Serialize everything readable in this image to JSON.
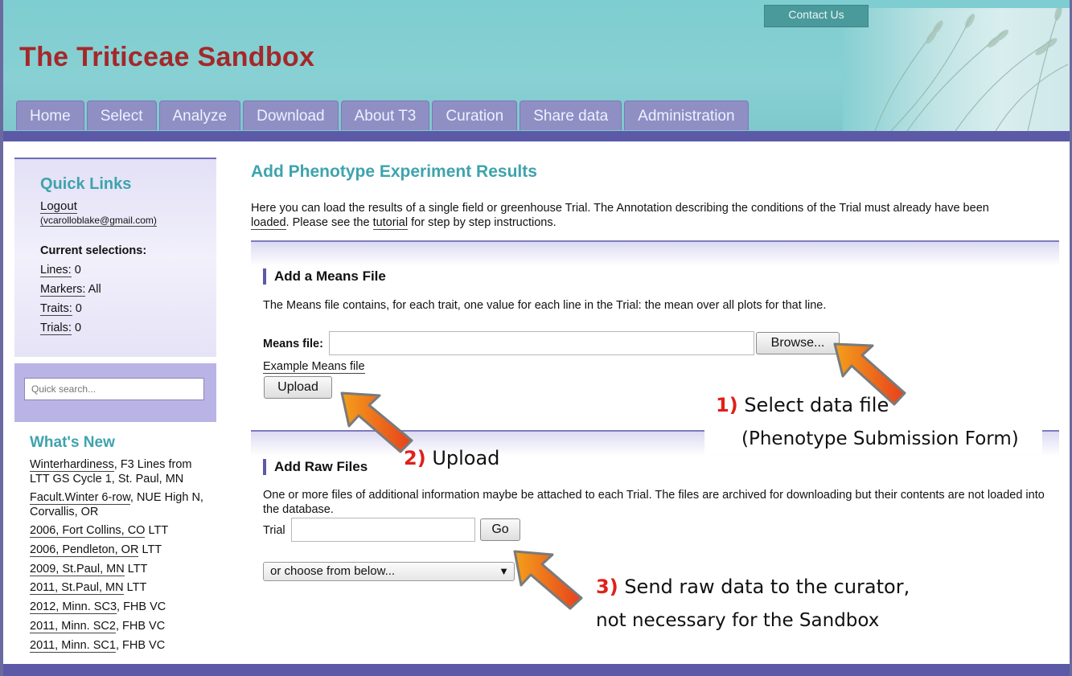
{
  "header": {
    "site_title": "The Triticeae Sandbox",
    "contact_label": "Contact Us"
  },
  "nav": {
    "tabs": [
      "Home",
      "Select",
      "Analyze",
      "Download",
      "About T3",
      "Curation",
      "Share data",
      "Administration"
    ]
  },
  "sidebar": {
    "quick_links_title": "Quick Links",
    "logout_label": "Logout",
    "user_email": "(vcarolloblake@gmail.com)",
    "current_selections_label": "Current selections:",
    "selections": [
      {
        "label": "Lines:",
        "value": "0"
      },
      {
        "label": "Markers:",
        "value": "All"
      },
      {
        "label": "Traits:",
        "value": "0"
      },
      {
        "label": "Trials:",
        "value": "0"
      }
    ],
    "search_placeholder": "Quick search...",
    "whats_new_title": "What's New",
    "whats_new": [
      {
        "link": "Winterhardiness",
        "rest": ", F3 Lines from LTT GS Cycle 1, St. Paul, MN"
      },
      {
        "link": "Facult.Winter 6-row",
        "rest": ", NUE High N, Corvallis, OR"
      },
      {
        "link": "2006, Fort Collins, CO",
        "rest": " LTT"
      },
      {
        "link": "2006, Pendleton, OR",
        "rest": " LTT"
      },
      {
        "link": "2009, St.Paul, MN",
        "rest": " LTT"
      },
      {
        "link": "2011, St.Paul, MN",
        "rest": " LTT"
      },
      {
        "link": "2012, Minn. SC3",
        "rest": ", FHB VC"
      },
      {
        "link": "2011, Minn. SC2",
        "rest": ", FHB VC"
      },
      {
        "link": "2011, Minn. SC1",
        "rest": ", FHB VC"
      }
    ]
  },
  "main": {
    "title": "Add Phenotype Experiment Results",
    "intro_part1": "Here you can load the results of a single field or greenhouse Trial. The Annotation describing the conditions of the Trial must already have been",
    "intro_loaded_link": "loaded",
    "intro_part2": ". Please see the ",
    "intro_tutorial_link": "tutorial",
    "intro_part3": " for step by step instructions.",
    "means": {
      "heading": "Add a Means File",
      "description": "The Means file contains, for each trait, one value for each line in the Trial: the mean over all plots for that line.",
      "file_label": "Means file:",
      "browse_label": "Browse...",
      "example_link": "Example Means file",
      "upload_label": "Upload"
    },
    "raw": {
      "heading": "Add Raw Files",
      "description": "One or more files of additional information maybe be attached to each Trial. The files are archived for downloading but their contents are not loaded into the database.",
      "trial_label": "Trial",
      "go_label": "Go",
      "choose_placeholder": "or choose from below..."
    }
  },
  "annotations": [
    {
      "num": "1)",
      "line1": "Select data file",
      "line2": "(Phenotype Submission Form)"
    },
    {
      "num": "2)",
      "line1": "Upload"
    },
    {
      "num": "3)",
      "line1": "Send raw data to the curator,",
      "line2": "not necessary for the Sandbox"
    }
  ],
  "colors": {
    "header_bg": "#7ecdd0",
    "title_red": "#a4282a",
    "nav_tab": "#8f8fc4",
    "nav_strip": "#5c5aa6",
    "heading_teal": "#3ea3ad",
    "annotation_red": "#e0201a",
    "arrow_orange": "#f05a1a"
  }
}
